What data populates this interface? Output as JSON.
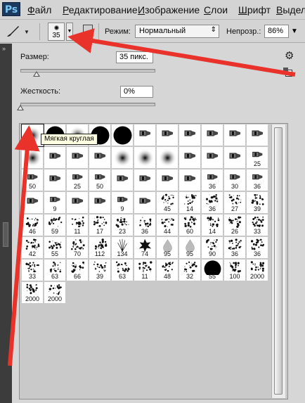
{
  "app": {
    "logo": "Ps"
  },
  "menu": [
    {
      "label": "Файл",
      "u": "Ф",
      "rest": "айл"
    },
    {
      "label": "Редактирование",
      "u": "Р",
      "rest": "едактирование"
    },
    {
      "label": "Изображение",
      "u": "И",
      "rest": "зображение"
    },
    {
      "label": "Слои",
      "u": "С",
      "rest": "лои"
    },
    {
      "label": "Шрифт",
      "u": "Ш",
      "rest": "рифт"
    },
    {
      "label": "Выделе",
      "u": "В",
      "rest": "ыделе"
    }
  ],
  "options": {
    "brush_size": "35",
    "mode_label": "Режим:",
    "mode_value": "Нормальный",
    "opacity_label": "Непрозр.:",
    "opacity_value": "86%"
  },
  "picker": {
    "size_label": "Размер:",
    "size_value": "35 пикс.",
    "size_slider": 0.12,
    "hardness_label": "Жесткость:",
    "hardness_value": "0%",
    "hardness_slider": 0.0,
    "tooltip": "Мягкая круглая"
  },
  "brushes": [
    [
      "soft",
      "hard",
      "soft",
      "hard",
      "hard",
      "tip",
      "tip",
      "tip",
      "tip",
      "tip",
      "tip"
    ],
    [
      "soft",
      "tip",
      "tip",
      "tip",
      "soft",
      "soft",
      "soft",
      "tip",
      "tip",
      "tip",
      "tip:25"
    ],
    [
      "tip:50",
      "tip",
      "tip:25",
      "tip:50",
      "tip",
      "tip",
      "tip",
      "tip",
      "tip:36",
      "tip:30",
      "tip:36"
    ],
    [
      "tip",
      "tip:9",
      "tip",
      "tip",
      "tip:9",
      "tip",
      "spl:45",
      "spl:14",
      "spl:36",
      "spl:27",
      "spl:39"
    ],
    [
      "spl:46",
      "spl:59",
      "spl:11",
      "spl:17",
      "spl:23",
      "spl:36",
      "spl:44",
      "spl:60",
      "spl:14",
      "spl:26",
      "spl:33"
    ],
    [
      "spl:42",
      "spl:55",
      "spl:70",
      "spl:112",
      "grass:134",
      "leaf:74",
      "drop:95",
      "drop:95",
      "spl:90",
      "spl:36",
      "spl:36"
    ],
    [
      "spl:33",
      "spl:63",
      "spl:66",
      "spl:39",
      "spl:63",
      "spl:11",
      "spl:48",
      "spl:32",
      "hard:55",
      "spl:100",
      "spl:2000"
    ],
    [
      "spl:2000",
      "spl:2000"
    ]
  ],
  "colors": {
    "arrow": "#e8322a",
    "panel_bg": "#d6d6d6",
    "menubar": "#d4d4d4"
  }
}
